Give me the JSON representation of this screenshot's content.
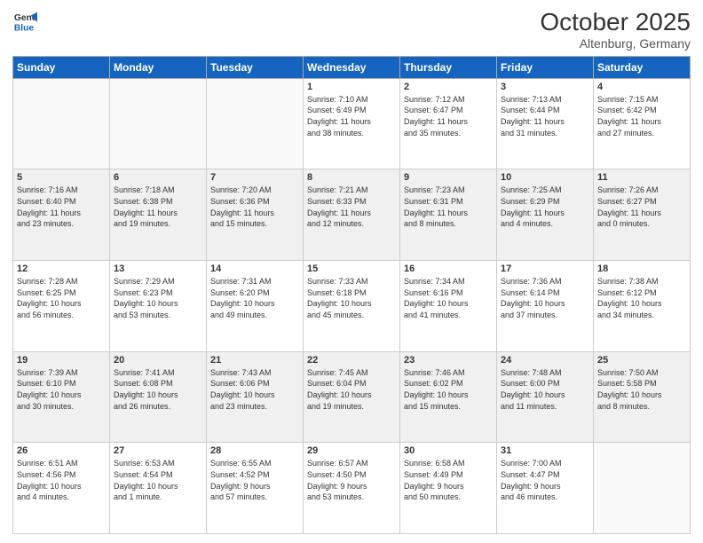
{
  "logo": {
    "line1": "General",
    "line2": "Blue"
  },
  "header": {
    "month": "October 2025",
    "location": "Altenburg, Germany"
  },
  "weekdays": [
    "Sunday",
    "Monday",
    "Tuesday",
    "Wednesday",
    "Thursday",
    "Friday",
    "Saturday"
  ],
  "weeks": [
    [
      {
        "day": "",
        "info": ""
      },
      {
        "day": "",
        "info": ""
      },
      {
        "day": "",
        "info": ""
      },
      {
        "day": "1",
        "info": "Sunrise: 7:10 AM\nSunset: 6:49 PM\nDaylight: 11 hours\nand 38 minutes."
      },
      {
        "day": "2",
        "info": "Sunrise: 7:12 AM\nSunset: 6:47 PM\nDaylight: 11 hours\nand 35 minutes."
      },
      {
        "day": "3",
        "info": "Sunrise: 7:13 AM\nSunset: 6:44 PM\nDaylight: 11 hours\nand 31 minutes."
      },
      {
        "day": "4",
        "info": "Sunrise: 7:15 AM\nSunset: 6:42 PM\nDaylight: 11 hours\nand 27 minutes."
      }
    ],
    [
      {
        "day": "5",
        "info": "Sunrise: 7:16 AM\nSunset: 6:40 PM\nDaylight: 11 hours\nand 23 minutes."
      },
      {
        "day": "6",
        "info": "Sunrise: 7:18 AM\nSunset: 6:38 PM\nDaylight: 11 hours\nand 19 minutes."
      },
      {
        "day": "7",
        "info": "Sunrise: 7:20 AM\nSunset: 6:36 PM\nDaylight: 11 hours\nand 15 minutes."
      },
      {
        "day": "8",
        "info": "Sunrise: 7:21 AM\nSunset: 6:33 PM\nDaylight: 11 hours\nand 12 minutes."
      },
      {
        "day": "9",
        "info": "Sunrise: 7:23 AM\nSunset: 6:31 PM\nDaylight: 11 hours\nand 8 minutes."
      },
      {
        "day": "10",
        "info": "Sunrise: 7:25 AM\nSunset: 6:29 PM\nDaylight: 11 hours\nand 4 minutes."
      },
      {
        "day": "11",
        "info": "Sunrise: 7:26 AM\nSunset: 6:27 PM\nDaylight: 11 hours\nand 0 minutes."
      }
    ],
    [
      {
        "day": "12",
        "info": "Sunrise: 7:28 AM\nSunset: 6:25 PM\nDaylight: 10 hours\nand 56 minutes."
      },
      {
        "day": "13",
        "info": "Sunrise: 7:29 AM\nSunset: 6:23 PM\nDaylight: 10 hours\nand 53 minutes."
      },
      {
        "day": "14",
        "info": "Sunrise: 7:31 AM\nSunset: 6:20 PM\nDaylight: 10 hours\nand 49 minutes."
      },
      {
        "day": "15",
        "info": "Sunrise: 7:33 AM\nSunset: 6:18 PM\nDaylight: 10 hours\nand 45 minutes."
      },
      {
        "day": "16",
        "info": "Sunrise: 7:34 AM\nSunset: 6:16 PM\nDaylight: 10 hours\nand 41 minutes."
      },
      {
        "day": "17",
        "info": "Sunrise: 7:36 AM\nSunset: 6:14 PM\nDaylight: 10 hours\nand 37 minutes."
      },
      {
        "day": "18",
        "info": "Sunrise: 7:38 AM\nSunset: 6:12 PM\nDaylight: 10 hours\nand 34 minutes."
      }
    ],
    [
      {
        "day": "19",
        "info": "Sunrise: 7:39 AM\nSunset: 6:10 PM\nDaylight: 10 hours\nand 30 minutes."
      },
      {
        "day": "20",
        "info": "Sunrise: 7:41 AM\nSunset: 6:08 PM\nDaylight: 10 hours\nand 26 minutes."
      },
      {
        "day": "21",
        "info": "Sunrise: 7:43 AM\nSunset: 6:06 PM\nDaylight: 10 hours\nand 23 minutes."
      },
      {
        "day": "22",
        "info": "Sunrise: 7:45 AM\nSunset: 6:04 PM\nDaylight: 10 hours\nand 19 minutes."
      },
      {
        "day": "23",
        "info": "Sunrise: 7:46 AM\nSunset: 6:02 PM\nDaylight: 10 hours\nand 15 minutes."
      },
      {
        "day": "24",
        "info": "Sunrise: 7:48 AM\nSunset: 6:00 PM\nDaylight: 10 hours\nand 11 minutes."
      },
      {
        "day": "25",
        "info": "Sunrise: 7:50 AM\nSunset: 5:58 PM\nDaylight: 10 hours\nand 8 minutes."
      }
    ],
    [
      {
        "day": "26",
        "info": "Sunrise: 6:51 AM\nSunset: 4:56 PM\nDaylight: 10 hours\nand 4 minutes."
      },
      {
        "day": "27",
        "info": "Sunrise: 6:53 AM\nSunset: 4:54 PM\nDaylight: 10 hours\nand 1 minute."
      },
      {
        "day": "28",
        "info": "Sunrise: 6:55 AM\nSunset: 4:52 PM\nDaylight: 9 hours\nand 57 minutes."
      },
      {
        "day": "29",
        "info": "Sunrise: 6:57 AM\nSunset: 4:50 PM\nDaylight: 9 hours\nand 53 minutes."
      },
      {
        "day": "30",
        "info": "Sunrise: 6:58 AM\nSunset: 4:49 PM\nDaylight: 9 hours\nand 50 minutes."
      },
      {
        "day": "31",
        "info": "Sunrise: 7:00 AM\nSunset: 4:47 PM\nDaylight: 9 hours\nand 46 minutes."
      },
      {
        "day": "",
        "info": ""
      }
    ]
  ]
}
